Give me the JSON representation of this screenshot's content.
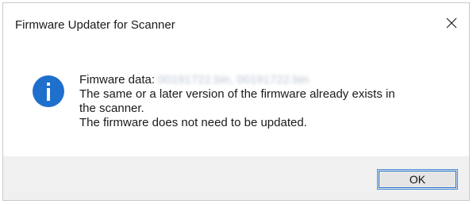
{
  "window": {
    "title": "Firmware Updater for Scanner",
    "close_icon": "close-icon"
  },
  "message": {
    "icon": "info-icon",
    "firmware_label": "Fimware data:",
    "firmware_value_blurred": "00191722.bin, 00191722.bin",
    "line2": "The same or a later version of the firmware already exists in",
    "line3": "the scanner.",
    "line4": "The firmware does not need to be updated."
  },
  "footer": {
    "ok_label": "OK"
  },
  "colors": {
    "info_icon": "#1f6fcc",
    "footer_bg": "#f0f0f0",
    "button_border": "#1e6fd0"
  }
}
